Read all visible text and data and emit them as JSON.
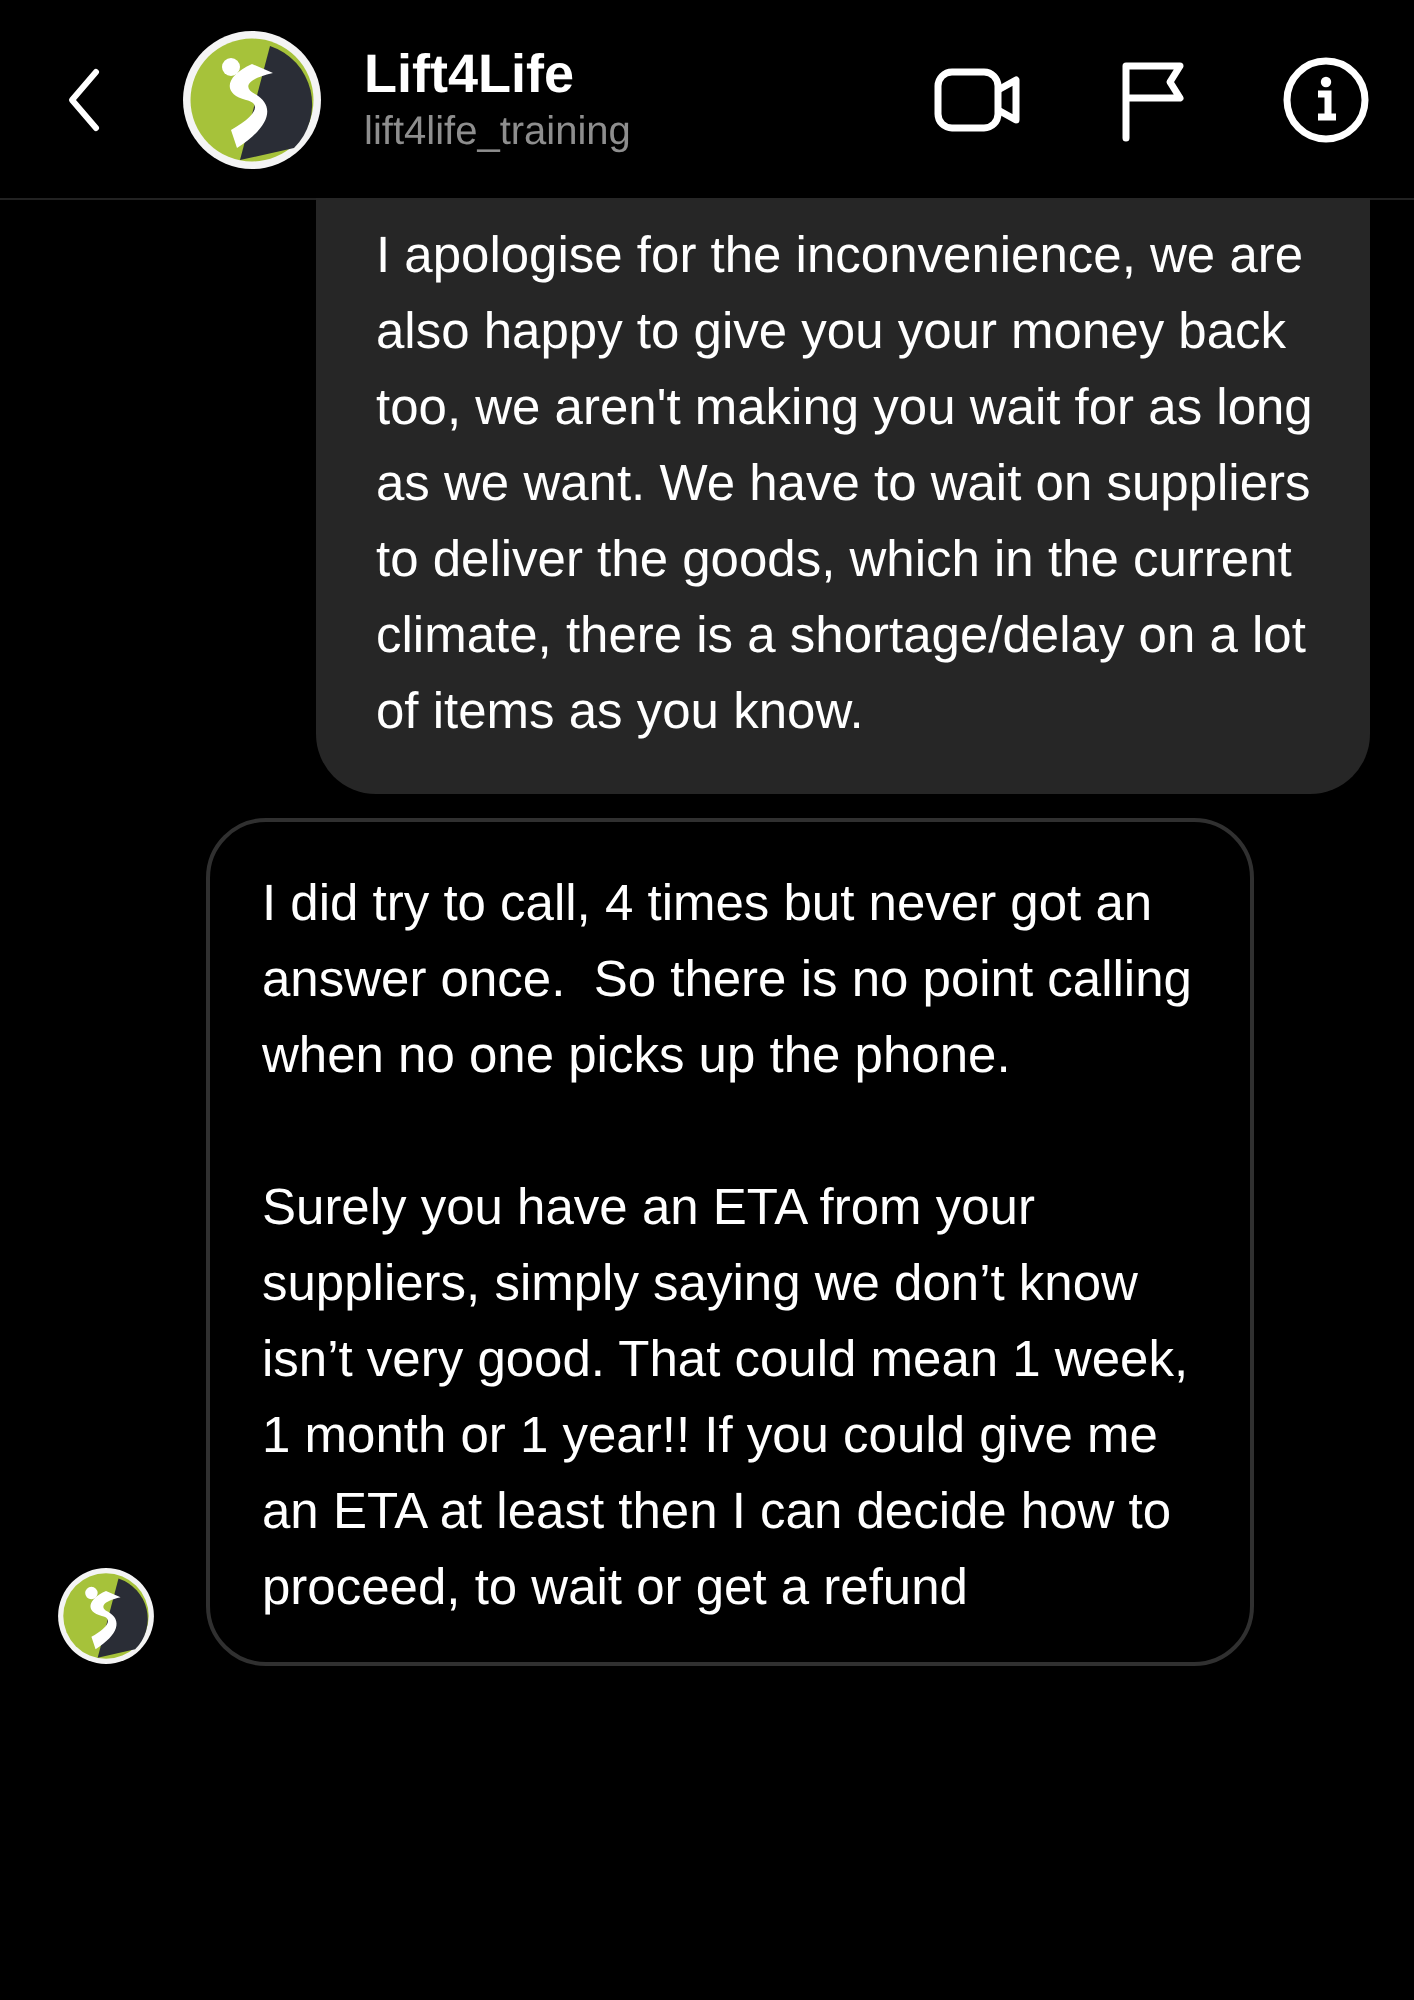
{
  "header": {
    "title": "Lift4Life",
    "subtitle": "lift4life_training"
  },
  "messages": [
    {
      "kind": "sent",
      "paragraphs": [
        "I apologise for the inconvenience, we are also happy to give you your money back too, we aren't making you wait for as long as we want. We have to wait on suppliers to deliver the goods, which in the current climate, there is a shortage/delay on a lot of items as you know."
      ]
    },
    {
      "kind": "received",
      "paragraphs": [
        "I did try to call, 4 times but never got an answer once.  So there is no point calling when no one picks up the phone.",
        "Surely you have an ETA from your suppliers, simply saying we don’t know isn’t very good. That could mean 1 week, 1 month or 1 year!! If you could give me an ETA at least then I can decide how to proceed, to wait or get a refund"
      ]
    }
  ]
}
